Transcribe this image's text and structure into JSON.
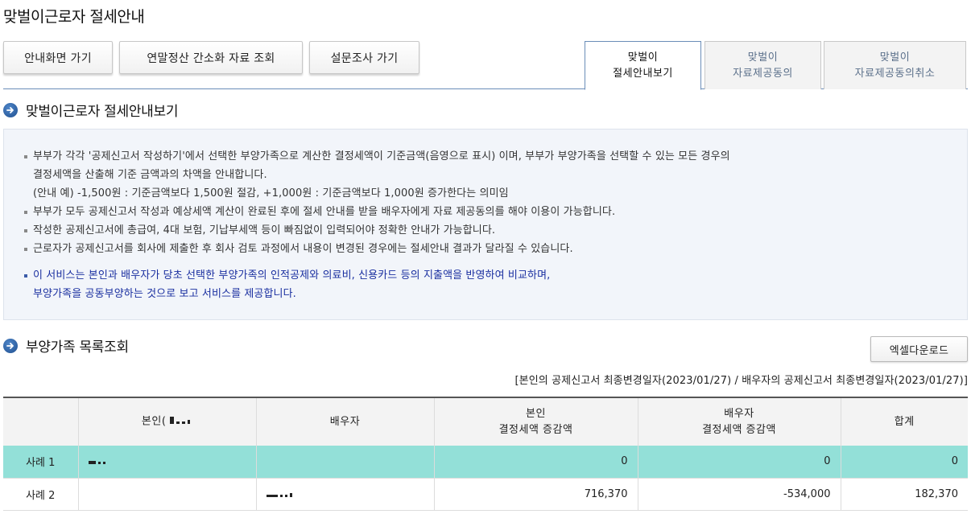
{
  "page": {
    "title": "맞벌이근로자 절세안내"
  },
  "top_buttons": [
    {
      "label": "안내화면 가기"
    },
    {
      "label": "연말정산 간소화 자료 조회"
    },
    {
      "label": "설문조사 가기"
    }
  ],
  "tabs": [
    {
      "line1": "맞벌이",
      "line2": "절세안내보기",
      "active": true
    },
    {
      "line1": "맞벌이",
      "line2": "자료제공동의",
      "active": false
    },
    {
      "line1": "맞벌이",
      "line2": "자료제공동의취소",
      "active": false
    }
  ],
  "section1": {
    "title": "맞벌이근로자 절세안내보기"
  },
  "notice": {
    "lines": [
      "부부가 각각 '공제신고서 작성하기'에서 선택한 부양가족으로 계산한 결정세액이 기준금액(음영으로 표시) 이며, 부부가 부양가족을 선택할 수 있는 모든 경우의",
      "결정세액을 산출해 기준 금액과의 차액을 안내합니다.",
      "(안내 예) -1,500원 : 기준금액보다 1,500원 절감, +1,000원 : 기준금액보다 1,000원 증가한다는 의미임",
      "부부가 모두 공제신고서 작성과 예상세액 계산이 완료된 후에 절세 안내를 받을 배우자에게 자료 제공동의를 해야 이용이 가능합니다.",
      "작성한 공제신고서에 총급여, 4대 보험, 기납부세액 등이 빠짐없이 입력되어야 정확한 안내가 가능합니다.",
      "근로자가 공제신고서를 회사에 제출한 후 회사 검토 과정에서 내용이 변경된 경우에는 절세안내 결과가 달라질 수 있습니다."
    ],
    "blue_lines": [
      "이 서비스는 본인과 배우자가 당초 선택한 부양가족의 인적공제와 의료비, 신용카드 등의 지출액을 반영하여 비교하며,",
      "부양가족을 공동부양하는 것으로 보고 서비스를 제공합니다."
    ]
  },
  "section2": {
    "title": "부양가족 목록조회"
  },
  "excel_button": {
    "label": "엑셀다운로드"
  },
  "date_note": "[본인의 공제신고서 최종변경일자(2023/01/27) / 배우자의 공제신고서 최종변경일자(2023/01/27)]",
  "table": {
    "headers": {
      "self": "본인(",
      "spouse": "배우자",
      "self_tax_1": "본인",
      "self_tax_2": "결정세액 증감액",
      "spouse_tax_1": "배우자",
      "spouse_tax_2": "결정세액 증감액",
      "total": "합계"
    },
    "rows": [
      {
        "case": "사례 1",
        "self_tax": "0",
        "spouse_tax": "0",
        "total": "0",
        "highlight": true
      },
      {
        "case": "사례 2",
        "self_tax": "716,370",
        "spouse_tax": "-534,000",
        "total": "182,370",
        "highlight": false
      }
    ]
  },
  "colors": {
    "accent": "#1f4f8f",
    "highlight_row": "#93e0d8",
    "notice_blue": "#1a2fa0"
  }
}
